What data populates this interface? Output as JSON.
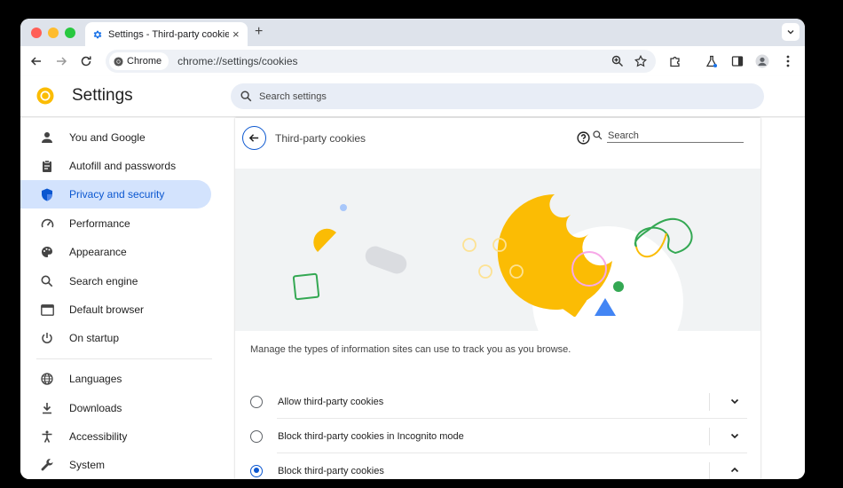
{
  "tab": {
    "title": "Settings - Third-party cookies",
    "close": "×",
    "new_tab": "+"
  },
  "omnibox": {
    "chip_label": "Chrome",
    "url": "chrome://settings/cookies"
  },
  "header": {
    "title": "Settings",
    "search_placeholder": "Search settings"
  },
  "sidebar": {
    "items": [
      {
        "label": "You and Google",
        "icon": "person-icon"
      },
      {
        "label": "Autofill and passwords",
        "icon": "clipboard-icon"
      },
      {
        "label": "Privacy and security",
        "icon": "shield-icon",
        "active": true
      },
      {
        "label": "Performance",
        "icon": "speedometer-icon"
      },
      {
        "label": "Appearance",
        "icon": "palette-icon"
      },
      {
        "label": "Search engine",
        "icon": "search-icon"
      },
      {
        "label": "Default browser",
        "icon": "browser-icon"
      },
      {
        "label": "On startup",
        "icon": "power-icon"
      },
      {
        "label": "Languages",
        "icon": "globe-icon"
      },
      {
        "label": "Downloads",
        "icon": "download-icon"
      },
      {
        "label": "Accessibility",
        "icon": "accessibility-icon"
      },
      {
        "label": "System",
        "icon": "wrench-icon"
      }
    ]
  },
  "page": {
    "title": "Third-party cookies",
    "search_placeholder": "Search",
    "description": "Manage the types of information sites can use to track you as you browse.",
    "options": [
      {
        "label": "Allow third-party cookies",
        "checked": false,
        "expanded": false
      },
      {
        "label": "Block third-party cookies in Incognito mode",
        "checked": false,
        "expanded": false
      },
      {
        "label": "Block third-party cookies",
        "checked": true,
        "expanded": true
      }
    ]
  },
  "colors": {
    "accent": "#0b57d0",
    "active_bg": "#d3e3fd",
    "cookie": "#fbbc04",
    "green": "#34a853",
    "pink": "#f7a8e8",
    "blue": "#4285f4"
  }
}
